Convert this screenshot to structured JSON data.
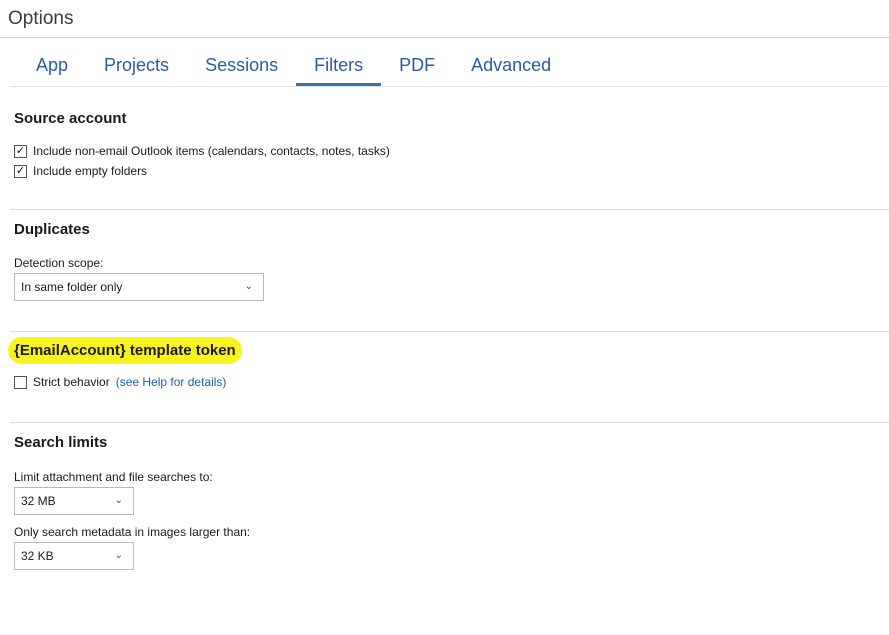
{
  "window": {
    "title": "Options"
  },
  "tabs": [
    {
      "label": "App",
      "active": false
    },
    {
      "label": "Projects",
      "active": false
    },
    {
      "label": "Sessions",
      "active": false
    },
    {
      "label": "Filters",
      "active": true
    },
    {
      "label": "PDF",
      "active": false
    },
    {
      "label": "Advanced",
      "active": false
    }
  ],
  "source_account": {
    "title": "Source account",
    "include_non_email": {
      "label": "Include non-email Outlook items (calendars, contacts, notes, tasks)",
      "checked": true
    },
    "include_empty_folders": {
      "label": "Include empty folders",
      "checked": true
    }
  },
  "duplicates": {
    "title": "Duplicates",
    "scope_label": "Detection scope:",
    "scope_value": "In same folder only"
  },
  "email_account_token": {
    "title": "{EmailAccount} template token",
    "strict": {
      "label": "Strict behavior",
      "checked": false
    },
    "help_link": "(see Help for details)"
  },
  "search_limits": {
    "title": "Search limits",
    "attachment_label": "Limit attachment and file searches to:",
    "attachment_value": "32 MB",
    "metadata_label": "Only search metadata in images larger than:",
    "metadata_value": "32 KB"
  },
  "colors": {
    "tab_text": "#2b5aa8",
    "tab_indicator": "#3a6ea5",
    "highlight": "#f8f31e",
    "link": "#1a5fb4"
  }
}
